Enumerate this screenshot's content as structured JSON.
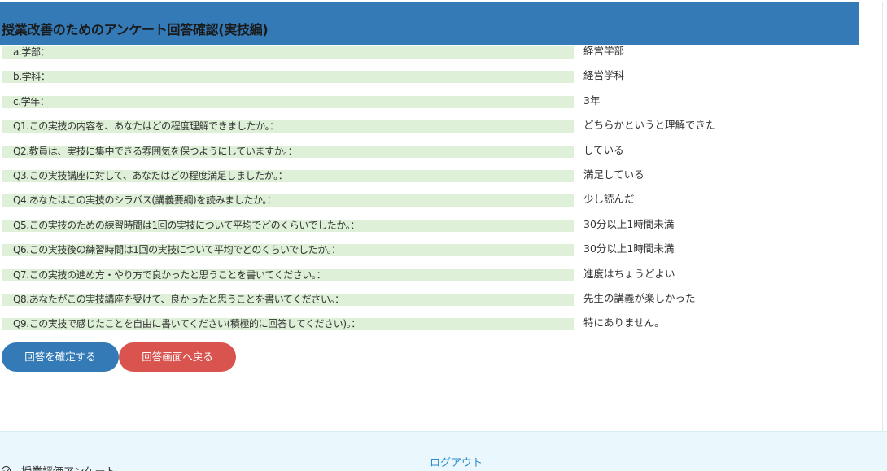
{
  "header": {
    "title": "授業改善のためのアンケート回答確認(実技編)"
  },
  "answers": [
    {
      "label": "a.学部：",
      "value": "経営学部"
    },
    {
      "label": "b.学科：",
      "value": "経営学科"
    },
    {
      "label": "c.学年：",
      "value": "3年"
    },
    {
      "label": "Q1.この実技の内容を、あなたはどの程度理解できましたか。：",
      "value": "どちらかというと理解できた"
    },
    {
      "label": "Q2.教員は、実技に集中できる雰囲気を保つようにしていますか。：",
      "value": "している"
    },
    {
      "label": "Q3.この実技講座に対して、あなたはどの程度満足しましたか。：",
      "value": "満足している"
    },
    {
      "label": "Q4.あなたはこの実技のシラバス(講義要綱)を読みましたか。：",
      "value": "少し読んだ"
    },
    {
      "label": "Q5.この実技のための練習時間は1回の実技について平均でどのくらいでしたか。：",
      "value": "30分以上1時間未満"
    },
    {
      "label": "Q6.この実技後の練習時間は1回の実技について平均でどのくらいでしたか。：",
      "value": "30分以上1時間未満"
    },
    {
      "label": "Q7.この実技の進め方・やり方で良かったと思うことを書いてください。：",
      "value": "進度はちょうどよい"
    },
    {
      "label": "Q8.あなたがこの実技講座を受けて、良かったと思うことを書いてください。：",
      "value": "先生の講義が楽しかった"
    },
    {
      "label": "Q9.この実技で感じたことを自由に書いてください(積極的に回答してください)。：",
      "value": "特にありません。"
    }
  ],
  "buttons": {
    "confirm_label": "回答を確定する",
    "back_label": "回答画面へ戻る"
  },
  "footer": {
    "logout_label": "ログアウト",
    "nav_item_label": "授業評価アンケート",
    "nav_item_icon": "circle-check-icon"
  },
  "colors": {
    "header_bg": "#337ab7",
    "label_bg": "#dff0d8",
    "confirm_button": "#337ab7",
    "back_button": "#d9534f",
    "footer_bg": "#eaf7fd",
    "link": "#2a8bd0"
  }
}
